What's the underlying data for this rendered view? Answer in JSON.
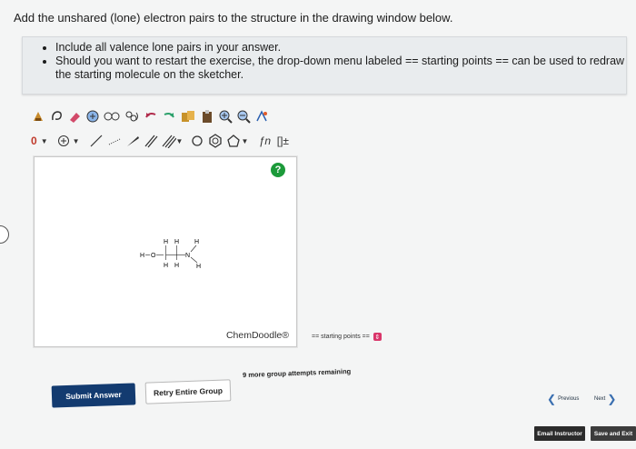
{
  "instruction": "Add the unshared (lone) electron pairs to the structure in the drawing window below.",
  "hints": [
    "Include all valence lone pairs in your answer.",
    "Should you want to restart the exercise, the drop-down menu labeled == starting points == can be used to redraw the starting molecule on the sketcher."
  ],
  "toolbar": {
    "charge_value": "0",
    "subscript_tool": "ƒn",
    "bracket_tool": "[]±"
  },
  "canvas": {
    "help_label": "?",
    "watermark": "ChemDoodle®",
    "molecule": {
      "top_row": "H  H      H",
      "main_row": "H–O–C–C–N",
      "bottom_row": "H  H       H"
    }
  },
  "dropdown": {
    "label": "== starting points ==",
    "arrow": "⇕"
  },
  "buttons": {
    "submit": "Submit Answer",
    "retry": "Retry Entire Group"
  },
  "attempts_text": "9 more group attempts remaining",
  "nav": {
    "previous": "Previous",
    "next": "Next"
  },
  "footer": {
    "email": "Email Instructor",
    "save": "Save and Exit"
  }
}
